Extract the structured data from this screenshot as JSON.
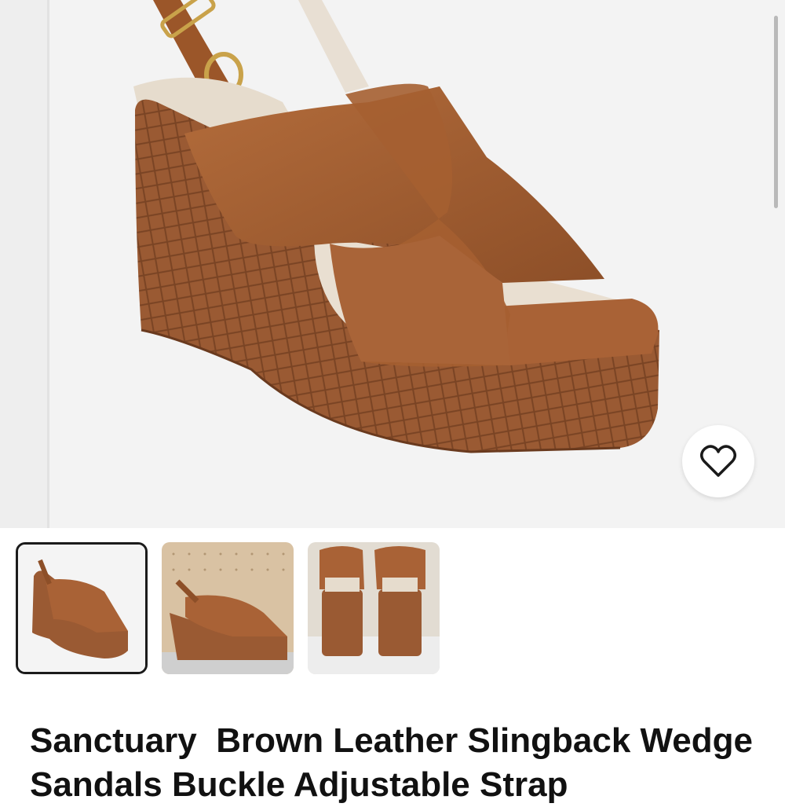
{
  "listing": {
    "title": "Sanctuary  Brown Leather Slingback Wedge Sandals Buckle Adjustable Strap"
  },
  "hero": {
    "image_alt": "Brown leather crisscross wedge sandal with woven wedge and slingback buckle strap"
  },
  "thumbnails": [
    {
      "alt": "Sandal side view",
      "selected": true
    },
    {
      "alt": "Sandal on pegboard background",
      "selected": false
    },
    {
      "alt": "Pair of sandals rear view",
      "selected": false
    }
  ],
  "favorite": {
    "icon": "heart-icon"
  },
  "colors": {
    "leather": "#a35f33",
    "leather_dark": "#7e4422",
    "wedge": "#9a5a33",
    "lining": "#ece3d6",
    "selected_border": "#1b1b1b"
  }
}
